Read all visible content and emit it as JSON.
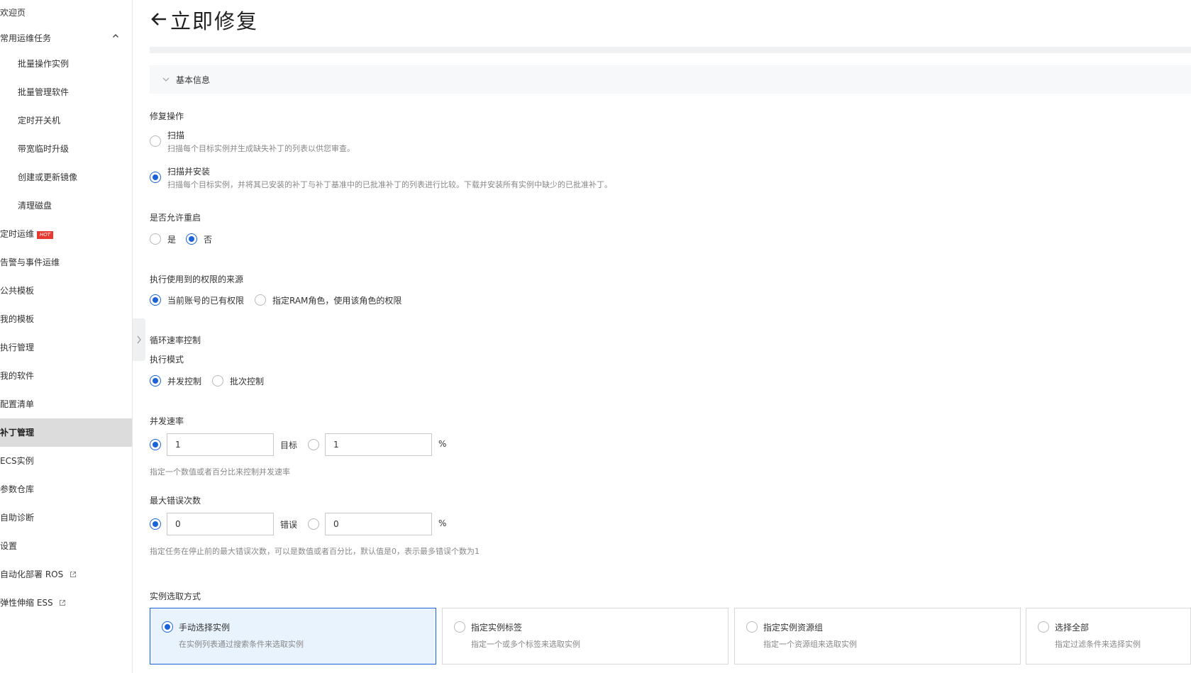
{
  "sidebar": {
    "items": [
      {
        "label": "欢迎页"
      },
      {
        "label": "常用运维任务"
      },
      {
        "label": "批量操作实例"
      },
      {
        "label": "批量管理软件"
      },
      {
        "label": "定时开关机"
      },
      {
        "label": "带宽临时升级"
      },
      {
        "label": "创建或更新镜像"
      },
      {
        "label": "清理磁盘"
      },
      {
        "label": "定时运维",
        "badge": "HOT"
      },
      {
        "label": "告警与事件运维"
      },
      {
        "label": "公共模板"
      },
      {
        "label": "我的模板"
      },
      {
        "label": "执行管理"
      },
      {
        "label": "我的软件"
      },
      {
        "label": "配置清单"
      },
      {
        "label": "补丁管理"
      },
      {
        "label": "ECS实例"
      },
      {
        "label": "参数仓库"
      },
      {
        "label": "自助诊断"
      },
      {
        "label": "设置"
      },
      {
        "label": "自动化部署 ROS"
      },
      {
        "label": "弹性伸缩 ESS"
      }
    ]
  },
  "page": {
    "title": "立即修复",
    "section_basic": "基本信息"
  },
  "form": {
    "repair_op": {
      "label": "修复操作",
      "options": [
        {
          "label": "扫描",
          "desc": "扫描每个目标实例并生成缺失补丁的列表以供您审查。",
          "selected": false
        },
        {
          "label": "扫描并安装",
          "desc": "扫描每个目标实例，并将其已安装的补丁与补丁基准中的已批准补丁的列表进行比较。下载并安装所有实例中缺少的已批准补丁。",
          "selected": true
        }
      ]
    },
    "reboot": {
      "label": "是否允许重启",
      "options": [
        {
          "label": "是",
          "selected": false
        },
        {
          "label": "否",
          "selected": true
        }
      ]
    },
    "permission": {
      "label": "执行使用到的权限的来源",
      "options": [
        {
          "label": "当前账号的已有权限",
          "selected": true
        },
        {
          "label": "指定RAM角色，使用该角色的权限",
          "selected": false
        }
      ]
    },
    "loop_rate": {
      "label": "循环速率控制",
      "mode_label": "执行模式",
      "options": [
        {
          "label": "并发控制",
          "selected": true
        },
        {
          "label": "批次控制",
          "selected": false
        }
      ]
    },
    "concurrency": {
      "label": "并发速率",
      "value": "1",
      "unit": "目标",
      "percent_value": "1",
      "percent_unit": "%",
      "hint": "指定一个数值或者百分比来控制并发速率"
    },
    "max_errors": {
      "label": "最大错误次数",
      "value": "0",
      "unit": "错误",
      "percent_value": "0",
      "percent_unit": "%",
      "hint": "指定任务在停止前的最大错误次数，可以是数值或者百分比，默认值是0，表示最多错误个数为1"
    },
    "instance_select": {
      "label": "实例选取方式",
      "cards": [
        {
          "title": "手动选择实例",
          "desc": "在实例列表通过搜索条件来选取实例",
          "selected": true
        },
        {
          "title": "指定实例标签",
          "desc": "指定一个或多个标签来选取实例",
          "selected": false
        },
        {
          "title": "指定实例资源组",
          "desc": "指定一个资源组来选取实例",
          "selected": false
        },
        {
          "title": "选择全部",
          "desc": "指定过滤条件来选择实例",
          "selected": false
        }
      ]
    }
  },
  "colors": {
    "accent": "#1a63d9",
    "hot": "#e8382f",
    "active_nav": "#dcdcdc"
  },
  "icons": [
    "back-arrow-icon",
    "chevron-up-icon",
    "chevron-down-icon",
    "chevron-right-icon",
    "external-link-icon"
  ]
}
